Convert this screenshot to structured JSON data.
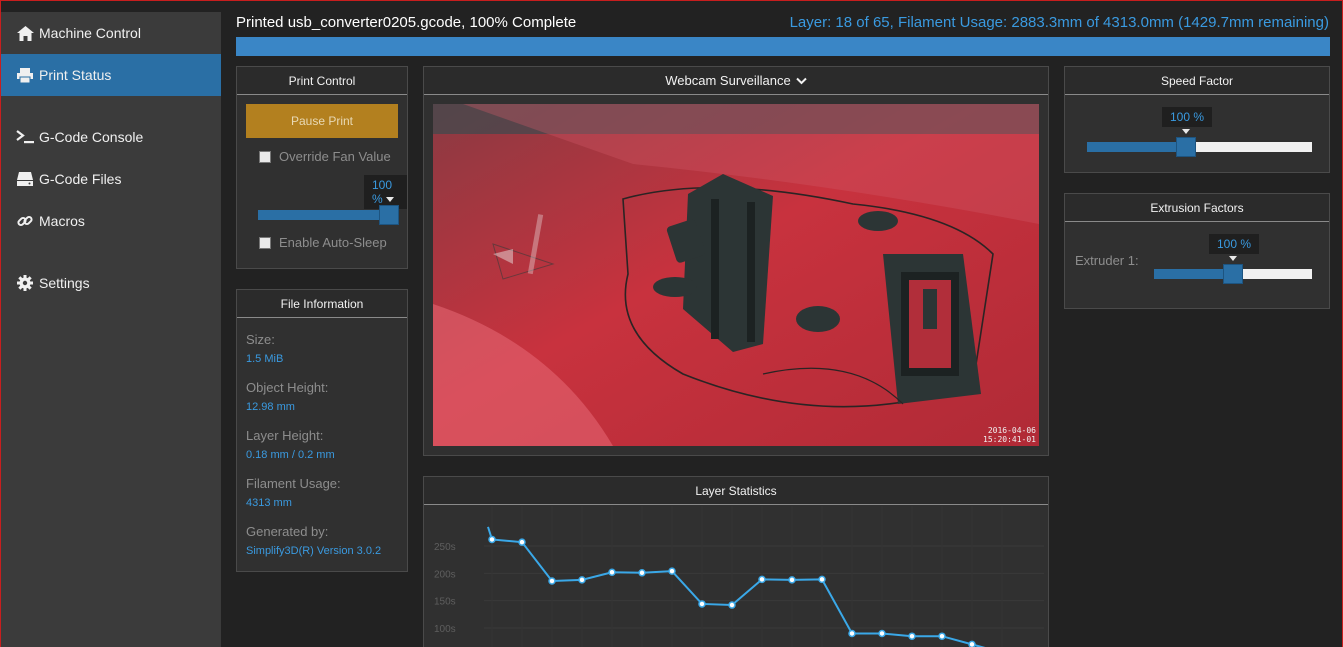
{
  "sidebar": {
    "items": [
      {
        "label": "Machine Control",
        "icon": "home-icon"
      },
      {
        "label": "Print Status",
        "icon": "printer-icon",
        "active": true
      },
      {
        "label": "G-Code Console",
        "icon": "terminal-icon"
      },
      {
        "label": "G-Code Files",
        "icon": "hdd-icon"
      },
      {
        "label": "Macros",
        "icon": "link-icon"
      },
      {
        "label": "Settings",
        "icon": "gear-icon"
      }
    ]
  },
  "header": {
    "title": "Printed usb_converter0205.gcode, 100% Complete",
    "layer_info": "Layer: 18 of 65, Filament Usage: 2883.3mm of 4313.0mm (1429.7mm remaining)",
    "progress": 1.0
  },
  "print_control": {
    "title": "Print Control",
    "pause_label": "Pause Print",
    "override_fan_label": "Override Fan Value",
    "fan_value_label": "100 %",
    "fan_value": 1.0,
    "auto_sleep_label": "Enable Auto-Sleep"
  },
  "file_info": {
    "title": "File Information",
    "fields": [
      {
        "label": "Size:",
        "value": "1.5 MiB"
      },
      {
        "label": "Object Height:",
        "value": "12.98 mm"
      },
      {
        "label": "Layer Height:",
        "value": "0.18 mm / 0.2 mm"
      },
      {
        "label": "Filament Usage:",
        "value": "4313 mm"
      },
      {
        "label": "Generated by:",
        "value": "Simplify3D(R) Version 3.0.2"
      }
    ]
  },
  "webcam": {
    "title": "Webcam Surveillance",
    "timestamp_date": "2016-04-06",
    "timestamp_time": "15:20:41-01"
  },
  "speed_factor": {
    "title": "Speed Factor",
    "value_label": "100 %",
    "value": 1.0
  },
  "extrusion": {
    "title": "Extrusion Factors",
    "extruder_label": "Extruder 1:",
    "value_label": "100 %",
    "value": 1.0
  },
  "colors": {
    "accent": "#2a6fa5",
    "link": "#3a9ae0",
    "pause": "#b3801f",
    "chart_line": "#3aa8e8"
  },
  "chart_data": {
    "type": "line",
    "title": "Layer Statistics",
    "y_ticks": [
      "250s",
      "200s",
      "150s",
      "100s"
    ],
    "series": [
      {
        "x": [
          1,
          2,
          3,
          4,
          5,
          6,
          7,
          8,
          9,
          10,
          11,
          12,
          13,
          14,
          15,
          16,
          17,
          18
        ],
        "values": [
          262,
          257,
          186,
          188,
          202,
          201,
          204,
          144,
          142,
          189,
          188,
          189,
          90,
          90,
          85,
          85,
          70,
          55
        ]
      }
    ],
    "ylim": [
      50,
      290
    ],
    "grid": true
  }
}
